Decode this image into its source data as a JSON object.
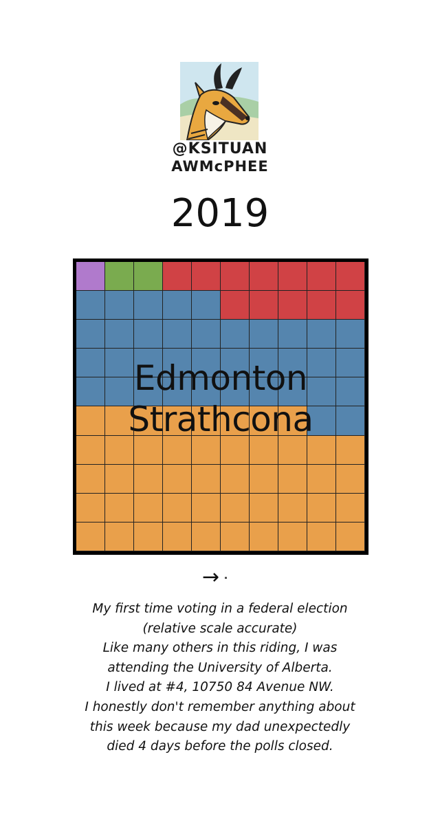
{
  "logo": {
    "handle_line1": "@KSITUAN",
    "handle_line2": "AWMcPHEE"
  },
  "year": "2019",
  "riding": {
    "line1": "Edmonton",
    "line2": "Strathcona"
  },
  "colors": {
    "purple": "#b07acc",
    "green": "#7aab4f",
    "red": "#d04245",
    "blue": "#5585ae",
    "orange": "#e9a04b"
  },
  "grid": {
    "rows": [
      [
        "purple",
        "green",
        "green",
        "red",
        "red",
        "red",
        "red",
        "red",
        "red",
        "red"
      ],
      [
        "blue",
        "blue",
        "blue",
        "blue",
        "blue",
        "red",
        "red",
        "red",
        "red",
        "red"
      ],
      [
        "blue",
        "blue",
        "blue",
        "blue",
        "blue",
        "blue",
        "blue",
        "blue",
        "blue",
        "blue"
      ],
      [
        "blue",
        "blue",
        "blue",
        "blue",
        "blue",
        "blue",
        "blue",
        "blue",
        "blue",
        "blue"
      ],
      [
        "blue",
        "blue",
        "blue",
        "blue",
        "blue",
        "blue",
        "blue",
        "blue",
        "blue",
        "blue"
      ],
      [
        "orange",
        "orange",
        "orange",
        "orange",
        "orange",
        "orange",
        "orange",
        "orange",
        "blue",
        "blue"
      ],
      [
        "orange",
        "orange",
        "orange",
        "orange",
        "orange",
        "orange",
        "orange",
        "orange",
        "orange",
        "orange"
      ],
      [
        "orange",
        "orange",
        "orange",
        "orange",
        "orange",
        "orange",
        "orange",
        "orange",
        "orange",
        "orange"
      ],
      [
        "orange",
        "orange",
        "orange",
        "orange",
        "orange",
        "orange",
        "orange",
        "orange",
        "orange",
        "orange"
      ],
      [
        "orange",
        "orange",
        "orange",
        "orange",
        "orange",
        "orange",
        "orange",
        "orange",
        "orange",
        "orange"
      ]
    ]
  },
  "arrow": "→",
  "caption": [
    "My first time voting in a federal election",
    "(relative scale accurate)",
    "Like many others in this riding, I was",
    "attending the University of Alberta.",
    "I lived at #4, 10750 84 Avenue NW.",
    "I honestly don't remember anything about",
    "this week because my dad unexpectedly",
    "died 4 days before the polls closed."
  ]
}
